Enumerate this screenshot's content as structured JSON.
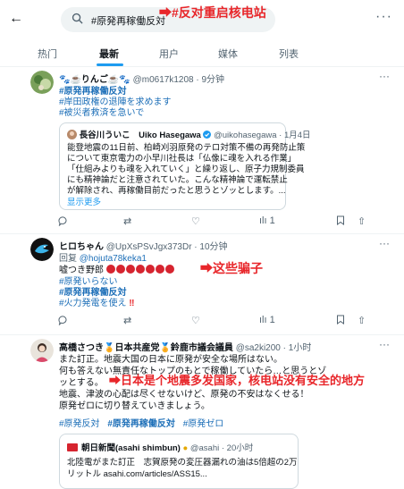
{
  "header": {
    "search_text": "#原発再稼働反対",
    "annotation": "➡#反对重启核电站"
  },
  "tabs": [
    "热门",
    "最新",
    "用户",
    "媒体",
    "列表"
  ],
  "post1": {
    "name": "🐾☕りんご☕🐾",
    "handle": "@m0617k1208 · 9分钟",
    "tags": [
      "#原発再稼働反対",
      "#岸田政権の退陣を求めます",
      "#被災者救済を急いで"
    ],
    "quote": {
      "name": "長谷川ういこ　Uiko Hasegawa",
      "handle": "@uikohasegawa · 1月4日",
      "lines": [
        "能登地震の11日前、柏崎刈羽原発のテロ対策不備の再発防止策",
        "について東京電力の小早川社長は「仏像に魂を入れる作業」",
        "「仕組みよりも魂を入れていく」と繰り返し、原子力規制委員",
        "にも精神論だと注意されていた。こんな精神論で運転禁止",
        "が解除され、再稼働目前だったと思うとゾッとします。...",
        "显示更多"
      ]
    },
    "views": "1"
  },
  "post2": {
    "name": "ヒロちゃん",
    "handle": "@UpXsPSvJgx373Dr · 10分钟",
    "reply_prefix": "回复",
    "reply_to": "@hojuta78keka1",
    "text": "嘘つき野郎",
    "annotation": "➡这些骗子",
    "tags": [
      "#原発いらない",
      "#原発再稼働反対",
      "#火力発電を使え"
    ],
    "exclaim": "‼",
    "views": "1"
  },
  "post3": {
    "name": "高橋さつき🏅日本共産党🏅鈴鹿市議会議員",
    "handle": "@sa2ki200 · 1小时",
    "lines": [
      "また訂正。地震大国の日本に原発が安全な場所はない。",
      "何も答えない無責任なトップのもとで稼働していたら…と思うとゾ",
      "ッとする。",
      "地震、津波の心配は尽くせないけど、原発の不安はなくせる！",
      "原発ゼロに切り替えていきましょう。"
    ],
    "annotation": "➡日本是个地震多发国家，核电站没有安全的地方",
    "tags": [
      "#原発反対",
      "#原発再稼働反対",
      "#原発ゼロ"
    ],
    "quote": {
      "name": "朝日新聞(asahi shimbun)",
      "handle": "@asahi · 20小时",
      "lines": [
        "北陸電がまた訂正　志賀原発の変圧器漏れの油は5倍超の2万",
        "リットル asahi.com/articles/ASS15..."
      ]
    }
  }
}
